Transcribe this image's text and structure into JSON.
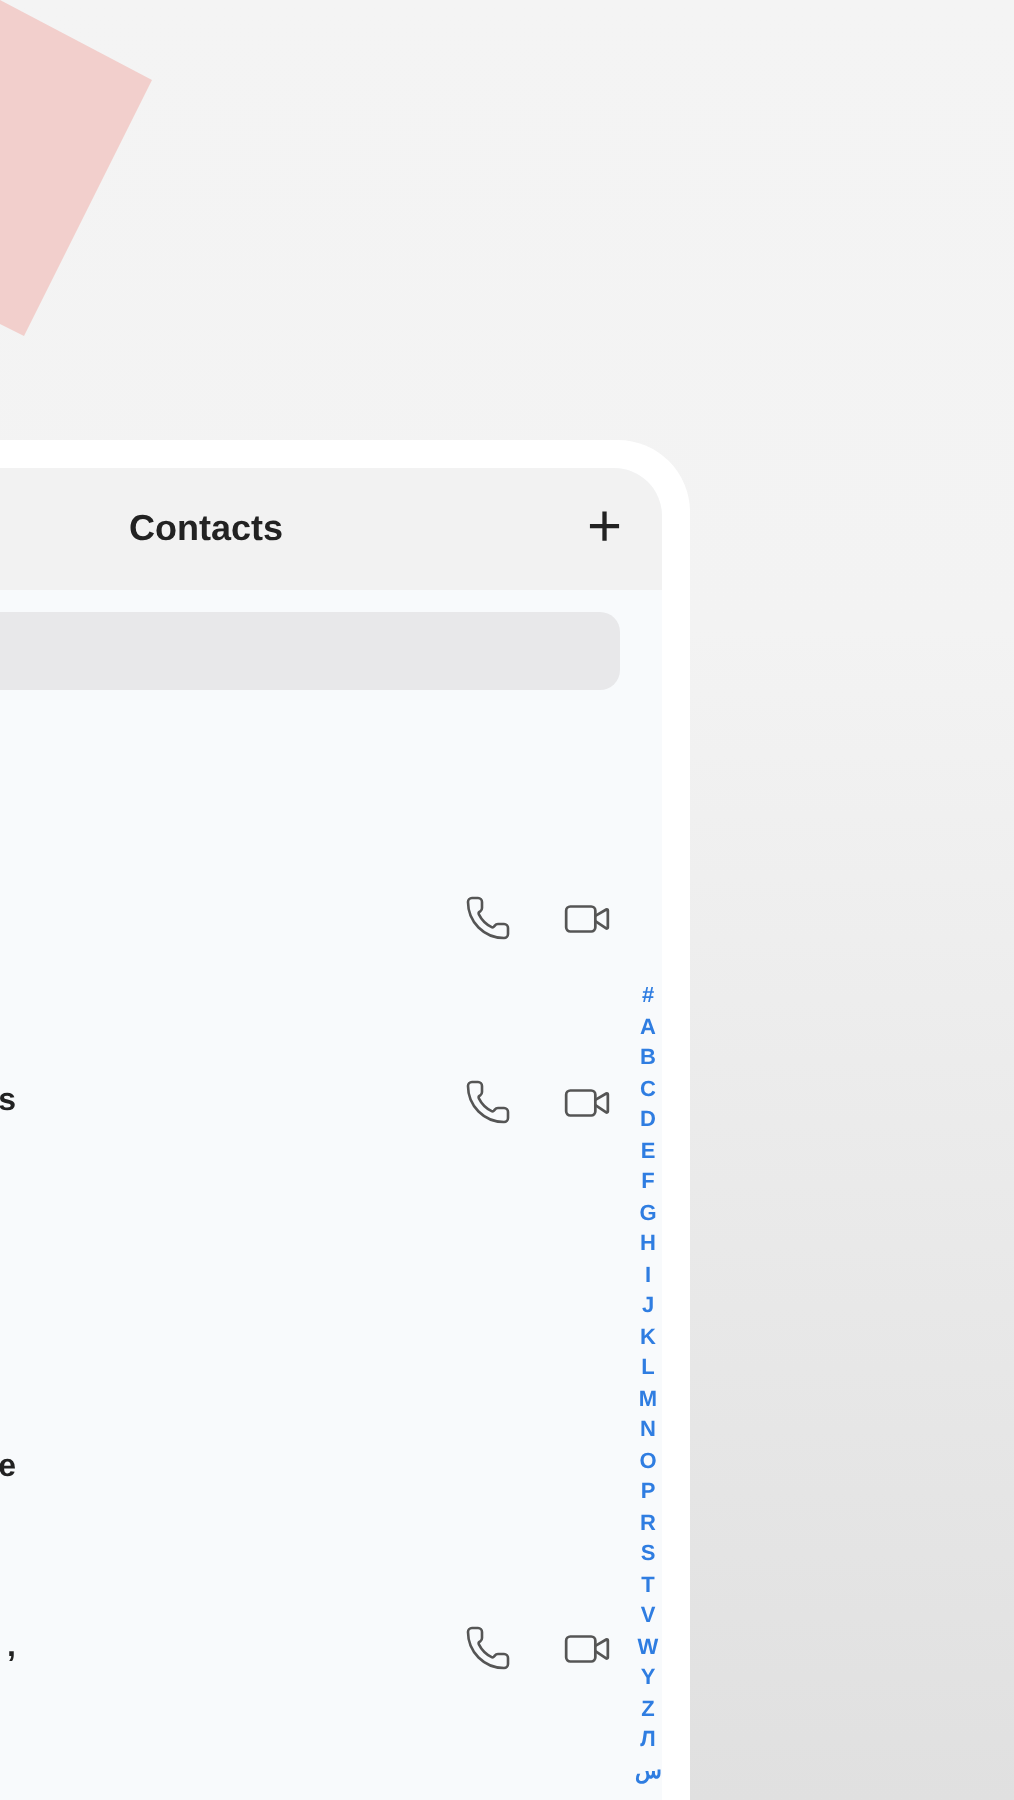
{
  "header": {
    "title": "Contacts",
    "add_icon": "+"
  },
  "contacts": [
    {
      "actions": true
    },
    {
      "name": "s",
      "actions": true
    },
    {
      "name": "e",
      "actions": false
    },
    {
      "name": ",",
      "actions": true
    }
  ],
  "index": [
    "#",
    "A",
    "B",
    "C",
    "D",
    "E",
    "F",
    "G",
    "H",
    "I",
    "J",
    "K",
    "L",
    "M",
    "N",
    "O",
    "P",
    "R",
    "S",
    "T",
    "V",
    "W",
    "Y",
    "Z",
    "Л",
    "س"
  ]
}
